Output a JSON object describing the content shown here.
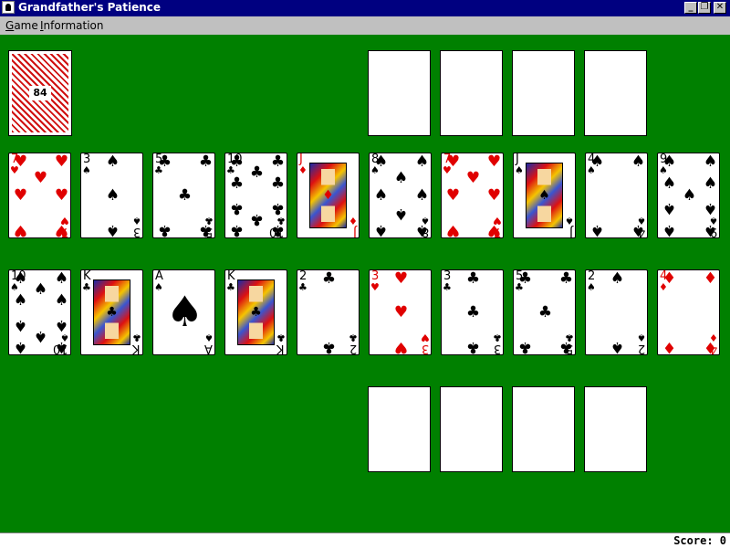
{
  "window": {
    "title": "Grandfather's Patience",
    "min": "_",
    "max": "❐",
    "close": "✕"
  },
  "menu": [
    {
      "label": "Game"
    },
    {
      "label": "Information"
    }
  ],
  "deck": {
    "count": "84"
  },
  "status": {
    "score_text": "Score: 0"
  },
  "rows": [
    [
      {
        "rank": "7",
        "suit": "hearts"
      },
      {
        "rank": "3",
        "suit": "spades"
      },
      {
        "rank": "5",
        "suit": "clubs"
      },
      {
        "rank": "10",
        "suit": "clubs"
      },
      {
        "rank": "J",
        "suit": "diamonds"
      },
      {
        "rank": "8",
        "suit": "spades"
      },
      {
        "rank": "7",
        "suit": "hearts"
      },
      {
        "rank": "J",
        "suit": "spades"
      },
      {
        "rank": "4",
        "suit": "spades"
      },
      {
        "rank": "9",
        "suit": "spades"
      }
    ],
    [
      {
        "rank": "10",
        "suit": "spades"
      },
      {
        "rank": "K",
        "suit": "clubs"
      },
      {
        "rank": "A",
        "suit": "spades"
      },
      {
        "rank": "K",
        "suit": "clubs"
      },
      {
        "rank": "2",
        "suit": "clubs"
      },
      {
        "rank": "3",
        "suit": "hearts"
      },
      {
        "rank": "3",
        "suit": "clubs"
      },
      {
        "rank": "5",
        "suit": "clubs"
      },
      {
        "rank": "2",
        "suit": "spades"
      },
      {
        "rank": "4",
        "suit": "diamonds"
      }
    ]
  ],
  "colors": {
    "felt": "#008000",
    "titlebar": "#000080",
    "red_suit": "#e00000"
  }
}
